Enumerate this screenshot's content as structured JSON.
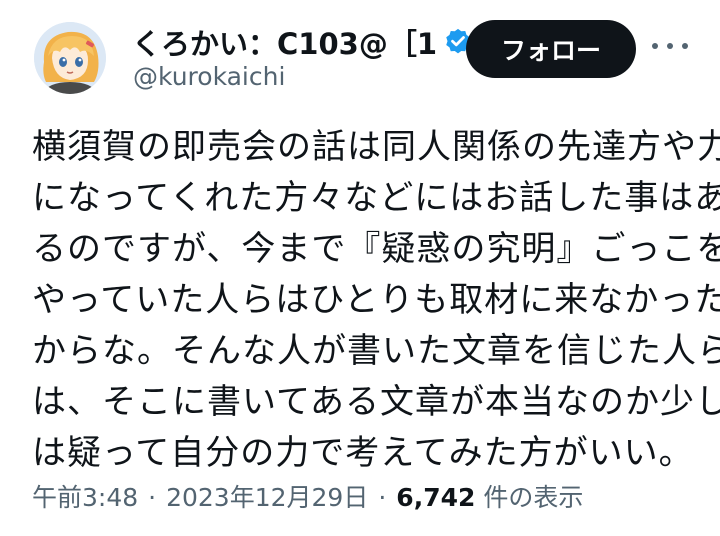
{
  "author": {
    "display_name": "くろかい：C103@［1",
    "handle": "@kurokaichi",
    "verified_icon": "verified-badge-icon",
    "avatar_icon": "anime-avatar"
  },
  "actions": {
    "follow_label": "フォロー",
    "more_icon": "more-options-icon"
  },
  "tweet": {
    "lines": [
      "横須賀の即売会の話は同人関係の先達方や力",
      "になってくれた方々などにはお話した事はあ",
      "るのですが、今まで『疑惑の究明』ごっこを",
      "やっていた人らはひとりも取材に来なかった",
      "からな。そんな人が書いた文章を信じた人ら",
      "は、そこに書いてある文章が本当なのか少し",
      "は疑って自分の力で考えてみた方がいい。"
    ]
  },
  "meta": {
    "time": "午前3:48",
    "separator": "·",
    "date": "2023年12月29日",
    "views_count": "6,742",
    "views_label": "件の表示"
  },
  "colors": {
    "text_primary": "#0f1419",
    "text_secondary": "#536471",
    "verified": "#1d9bf0",
    "button_bg": "#0f1419"
  }
}
